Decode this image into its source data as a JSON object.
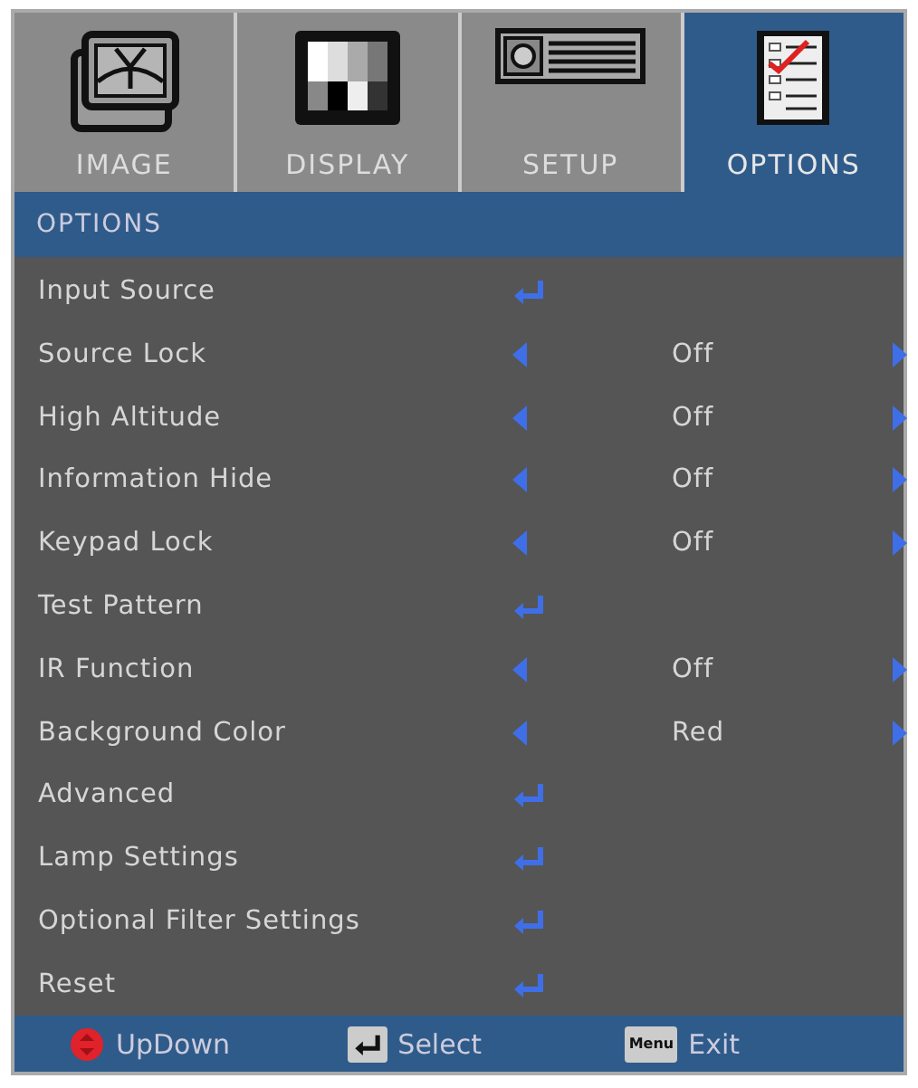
{
  "tabs": [
    {
      "label": "IMAGE",
      "kind": "image",
      "selected": false
    },
    {
      "label": "DISPLAY",
      "kind": "display",
      "selected": false
    },
    {
      "label": "SETUP",
      "kind": "setup",
      "selected": false
    },
    {
      "label": "OPTIONS",
      "kind": "options",
      "selected": true
    }
  ],
  "section_title": "OPTIONS",
  "items": [
    {
      "label": "Input Source",
      "kind": "enter"
    },
    {
      "label": "Source Lock",
      "kind": "choice",
      "value": "Off"
    },
    {
      "label": "High Altitude",
      "kind": "choice",
      "value": "Off"
    },
    {
      "label": "Information Hide",
      "kind": "choice",
      "value": "Off"
    },
    {
      "label": "Keypad Lock",
      "kind": "choice",
      "value": "Off"
    },
    {
      "label": "Test Pattern",
      "kind": "enter"
    },
    {
      "label": "IR Function",
      "kind": "choice",
      "value": "Off"
    },
    {
      "label": "Background Color",
      "kind": "choice",
      "value": "Red"
    },
    {
      "label": "Advanced",
      "kind": "enter"
    },
    {
      "label": "Lamp Settings",
      "kind": "enter"
    },
    {
      "label": "Optional Filter Settings",
      "kind": "enter"
    },
    {
      "label": "Reset",
      "kind": "enter"
    }
  ],
  "footer": [
    {
      "kind": "updown",
      "label": "UpDown"
    },
    {
      "kind": "enter",
      "label": "Select"
    },
    {
      "kind": "menu",
      "key": "Menu",
      "label": "Exit"
    }
  ]
}
